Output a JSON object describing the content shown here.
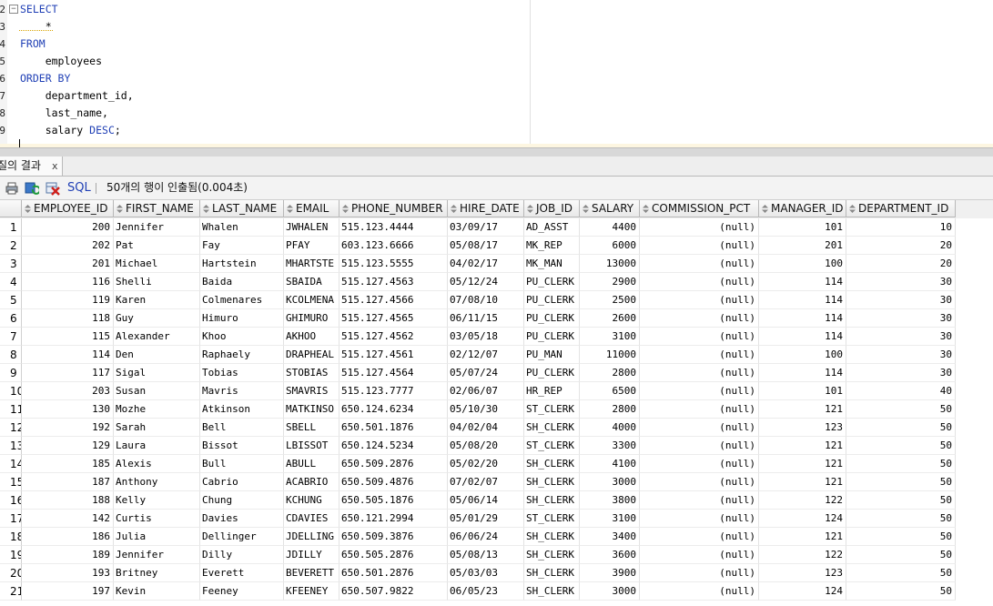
{
  "editor": {
    "lines": [
      {
        "no": "2",
        "text": "SELECT",
        "kind": "kw"
      },
      {
        "no": "3",
        "text": "    *",
        "kind": "star"
      },
      {
        "no": "4",
        "text": "FROM",
        "kind": "kw"
      },
      {
        "no": "5",
        "text": "    employees",
        "kind": "plain"
      },
      {
        "no": "6",
        "text": "ORDER BY",
        "kind": "kw"
      },
      {
        "no": "7",
        "text": "    department_id,",
        "kind": "plain"
      },
      {
        "no": "8",
        "text": "    last_name,",
        "kind": "plain"
      },
      {
        "no": "9",
        "text": "    salary ",
        "kind": "desc",
        "tail": "DESC",
        "end": ";"
      }
    ]
  },
  "results_tab": {
    "label": "질의 결과",
    "close": "x"
  },
  "toolbar": {
    "sql_label": "SQL",
    "status": "50개의 행이 인출됨(0.004초)"
  },
  "grid": {
    "columns": [
      "EMPLOYEE_ID",
      "FIRST_NAME",
      "LAST_NAME",
      "EMAIL",
      "PHONE_NUMBER",
      "HIRE_DATE",
      "JOB_ID",
      "SALARY",
      "COMMISSION_PCT",
      "MANAGER_ID",
      "DEPARTMENT_ID"
    ],
    "rows": [
      [
        "1",
        "200",
        "Jennifer",
        "Whalen",
        "JWHALEN",
        "515.123.4444",
        "03/09/17",
        "AD_ASST",
        "4400",
        "(null)",
        "101",
        "10"
      ],
      [
        "2",
        "202",
        "Pat",
        "Fay",
        "PFAY",
        "603.123.6666",
        "05/08/17",
        "MK_REP",
        "6000",
        "(null)",
        "201",
        "20"
      ],
      [
        "3",
        "201",
        "Michael",
        "Hartstein",
        "MHARTSTE",
        "515.123.5555",
        "04/02/17",
        "MK_MAN",
        "13000",
        "(null)",
        "100",
        "20"
      ],
      [
        "4",
        "116",
        "Shelli",
        "Baida",
        "SBAIDA",
        "515.127.4563",
        "05/12/24",
        "PU_CLERK",
        "2900",
        "(null)",
        "114",
        "30"
      ],
      [
        "5",
        "119",
        "Karen",
        "Colmenares",
        "KCOLMENA",
        "515.127.4566",
        "07/08/10",
        "PU_CLERK",
        "2500",
        "(null)",
        "114",
        "30"
      ],
      [
        "6",
        "118",
        "Guy",
        "Himuro",
        "GHIMURO",
        "515.127.4565",
        "06/11/15",
        "PU_CLERK",
        "2600",
        "(null)",
        "114",
        "30"
      ],
      [
        "7",
        "115",
        "Alexander",
        "Khoo",
        "AKHOO",
        "515.127.4562",
        "03/05/18",
        "PU_CLERK",
        "3100",
        "(null)",
        "114",
        "30"
      ],
      [
        "8",
        "114",
        "Den",
        "Raphaely",
        "DRAPHEAL",
        "515.127.4561",
        "02/12/07",
        "PU_MAN",
        "11000",
        "(null)",
        "100",
        "30"
      ],
      [
        "9",
        "117",
        "Sigal",
        "Tobias",
        "STOBIAS",
        "515.127.4564",
        "05/07/24",
        "PU_CLERK",
        "2800",
        "(null)",
        "114",
        "30"
      ],
      [
        "10",
        "203",
        "Susan",
        "Mavris",
        "SMAVRIS",
        "515.123.7777",
        "02/06/07",
        "HR_REP",
        "6500",
        "(null)",
        "101",
        "40"
      ],
      [
        "11",
        "130",
        "Mozhe",
        "Atkinson",
        "MATKINSO",
        "650.124.6234",
        "05/10/30",
        "ST_CLERK",
        "2800",
        "(null)",
        "121",
        "50"
      ],
      [
        "12",
        "192",
        "Sarah",
        "Bell",
        "SBELL",
        "650.501.1876",
        "04/02/04",
        "SH_CLERK",
        "4000",
        "(null)",
        "123",
        "50"
      ],
      [
        "13",
        "129",
        "Laura",
        "Bissot",
        "LBISSOT",
        "650.124.5234",
        "05/08/20",
        "ST_CLERK",
        "3300",
        "(null)",
        "121",
        "50"
      ],
      [
        "14",
        "185",
        "Alexis",
        "Bull",
        "ABULL",
        "650.509.2876",
        "05/02/20",
        "SH_CLERK",
        "4100",
        "(null)",
        "121",
        "50"
      ],
      [
        "15",
        "187",
        "Anthony",
        "Cabrio",
        "ACABRIO",
        "650.509.4876",
        "07/02/07",
        "SH_CLERK",
        "3000",
        "(null)",
        "121",
        "50"
      ],
      [
        "16",
        "188",
        "Kelly",
        "Chung",
        "KCHUNG",
        "650.505.1876",
        "05/06/14",
        "SH_CLERK",
        "3800",
        "(null)",
        "122",
        "50"
      ],
      [
        "17",
        "142",
        "Curtis",
        "Davies",
        "CDAVIES",
        "650.121.2994",
        "05/01/29",
        "ST_CLERK",
        "3100",
        "(null)",
        "124",
        "50"
      ],
      [
        "18",
        "186",
        "Julia",
        "Dellinger",
        "JDELLING",
        "650.509.3876",
        "06/06/24",
        "SH_CLERK",
        "3400",
        "(null)",
        "121",
        "50"
      ],
      [
        "19",
        "189",
        "Jennifer",
        "Dilly",
        "JDILLY",
        "650.505.2876",
        "05/08/13",
        "SH_CLERK",
        "3600",
        "(null)",
        "122",
        "50"
      ],
      [
        "20",
        "193",
        "Britney",
        "Everett",
        "BEVERETT",
        "650.501.2876",
        "05/03/03",
        "SH_CLERK",
        "3900",
        "(null)",
        "123",
        "50"
      ],
      [
        "21",
        "197",
        "Kevin",
        "Feeney",
        "KFEENEY",
        "650.507.9822",
        "06/05/23",
        "SH_CLERK",
        "3000",
        "(null)",
        "124",
        "50"
      ]
    ]
  }
}
